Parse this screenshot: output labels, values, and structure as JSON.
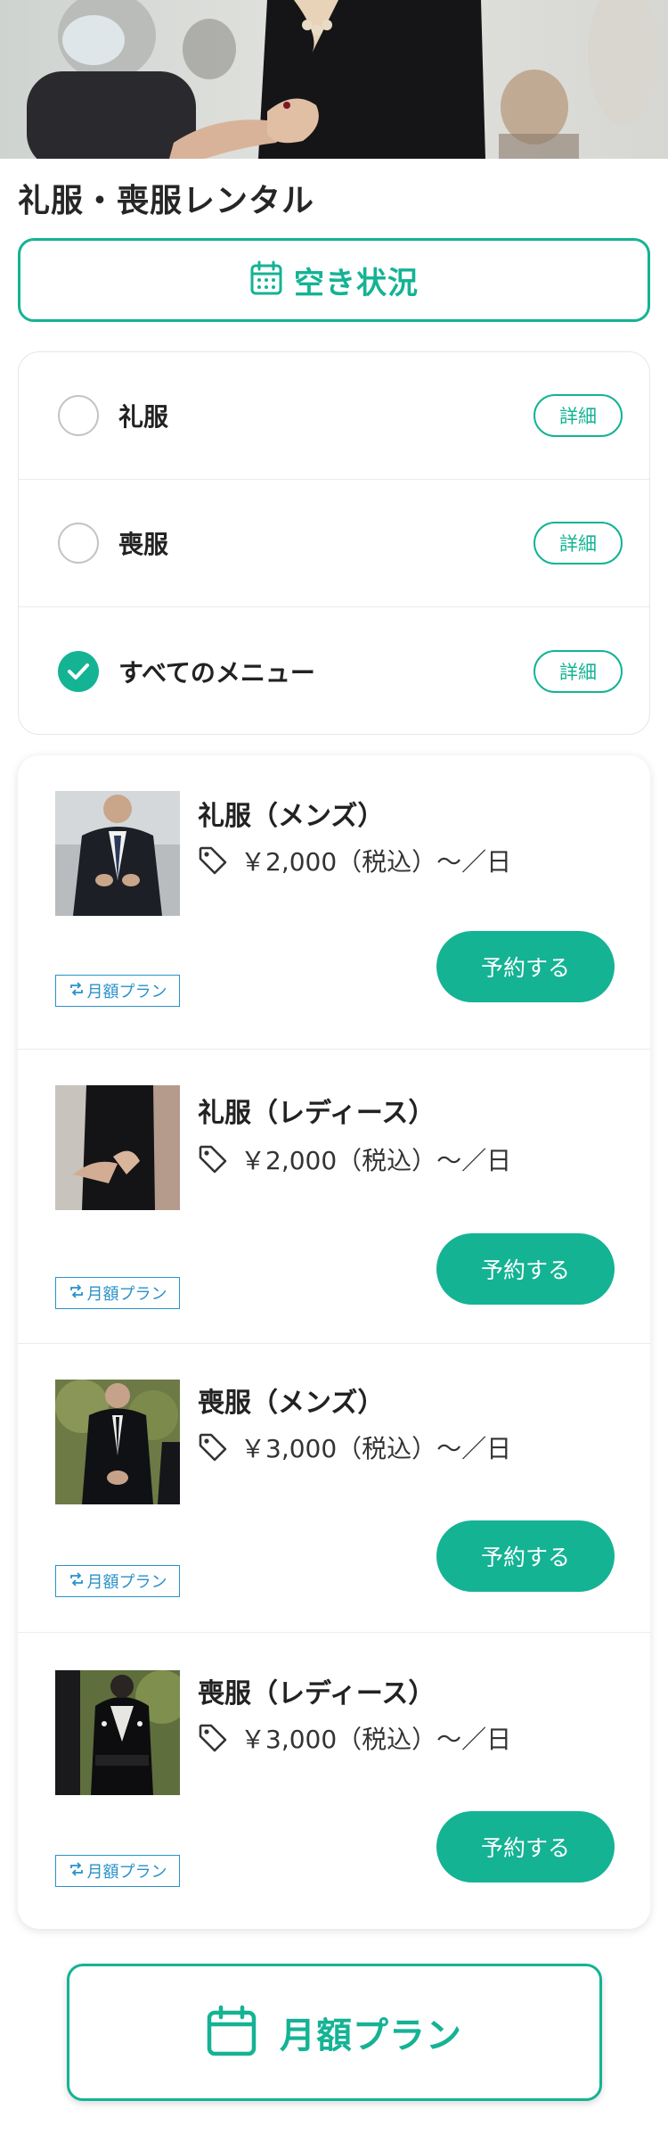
{
  "page_title": "礼服・喪服レンタル",
  "availability_button": {
    "label": "空き状況",
    "icon": "calendar-icon"
  },
  "filters": [
    {
      "label": "礼服",
      "checked": false,
      "detail_label": "詳細"
    },
    {
      "label": "喪服",
      "checked": false,
      "detail_label": "詳細"
    },
    {
      "label": "すべてのメニュー",
      "checked": true,
      "detail_label": "詳細"
    }
  ],
  "menu_items": [
    {
      "title": "礼服（メンズ）",
      "price": "￥2,000（税込）〜／日",
      "reserve_label": "予約する",
      "badge_label": "月額プラン",
      "thumb": "mens-formal-suit"
    },
    {
      "title": "礼服（レディース）",
      "price": "￥2,000（税込）〜／日",
      "reserve_label": "予約する",
      "badge_label": "月額プラン",
      "thumb": "ladies-formal-dress"
    },
    {
      "title": "喪服（メンズ）",
      "price": "￥3,000（税込）〜／日",
      "reserve_label": "予約する",
      "badge_label": "月額プラン",
      "thumb": "mens-mourning-suit"
    },
    {
      "title": "喪服（レディース）",
      "price": "￥3,000（税込）〜／日",
      "reserve_label": "予約する",
      "badge_label": "月額プラン",
      "thumb": "ladies-mourning-kimono"
    }
  ],
  "monthly_plan_button": {
    "label": "月額プラン",
    "icon": "calendar-icon"
  },
  "colors": {
    "accent": "#14b394",
    "badge": "#2a91c8",
    "text": "#222222"
  }
}
